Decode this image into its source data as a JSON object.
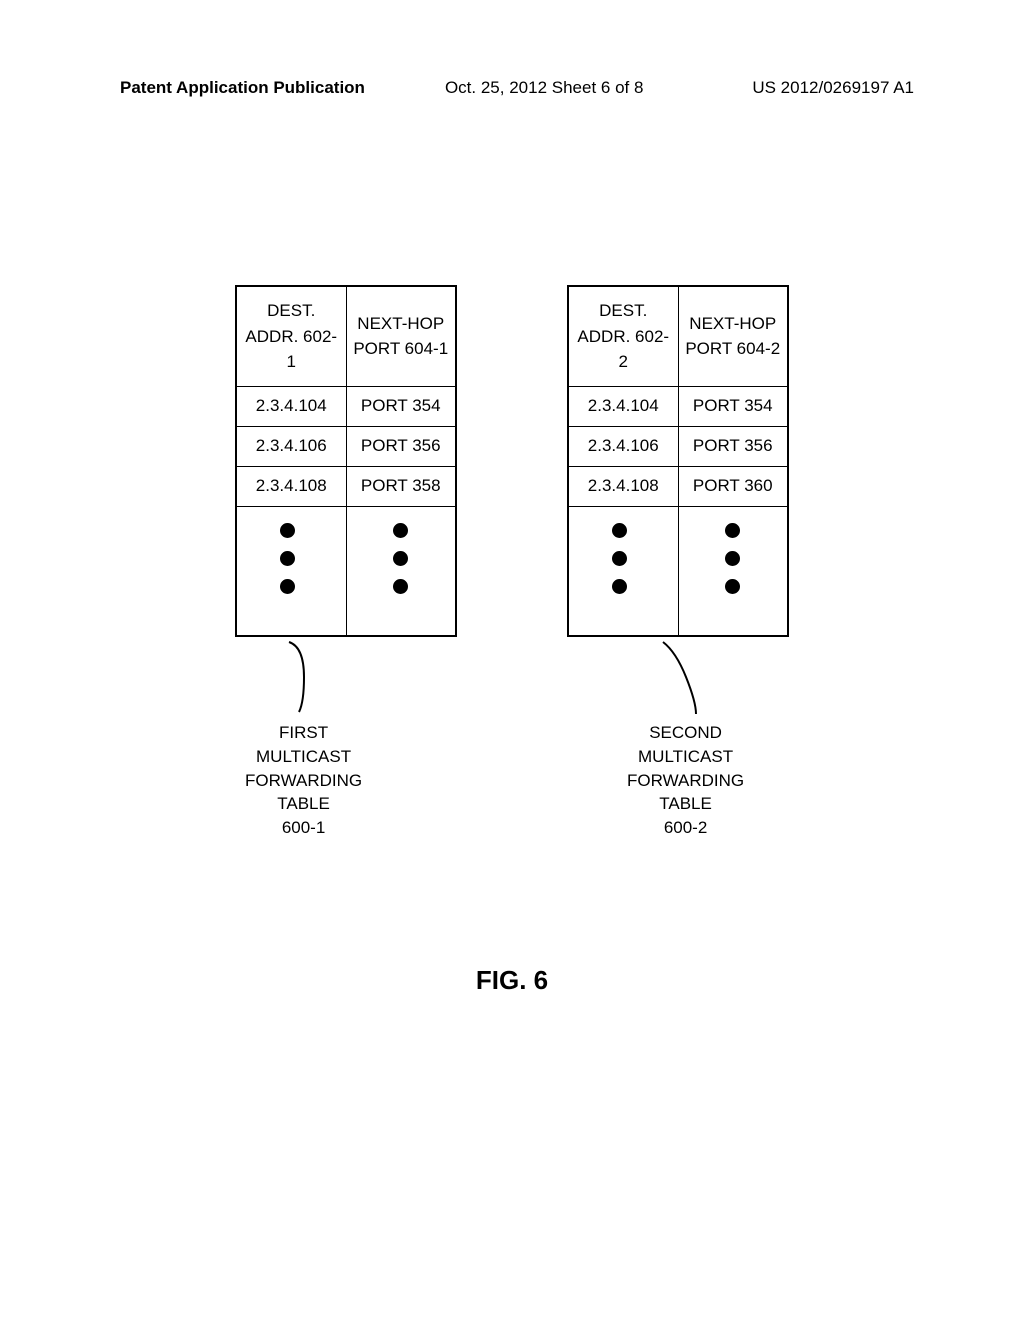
{
  "header": {
    "left": "Patent Application Publication",
    "center": "Oct. 25, 2012  Sheet 6 of 8",
    "right": "US 2012/0269197 A1"
  },
  "figure_label": "FIG. 6",
  "tables": [
    {
      "header_left": "DEST.\nADDR.\n602-1",
      "header_right": "NEXT-HOP\nPORT\n604-1",
      "rows": [
        {
          "dest": "2.3.4.104",
          "port": "PORT 354"
        },
        {
          "dest": "2.3.4.106",
          "port": "PORT 356"
        },
        {
          "dest": "2.3.4.108",
          "port": "PORT 358"
        }
      ],
      "caption": "FIRST\nMULTICAST\nFORWARDING\nTABLE\n600-1"
    },
    {
      "header_left": "DEST.\nADDR.\n602-2",
      "header_right": "NEXT-HOP\nPORT\n604-2",
      "rows": [
        {
          "dest": "2.3.4.104",
          "port": "PORT 354"
        },
        {
          "dest": "2.3.4.106",
          "port": "PORT 356"
        },
        {
          "dest": "2.3.4.108",
          "port": "PORT 360"
        }
      ],
      "caption": "SECOND\nMULTICAST\nFORWARDING\nTABLE\n600-2"
    }
  ]
}
